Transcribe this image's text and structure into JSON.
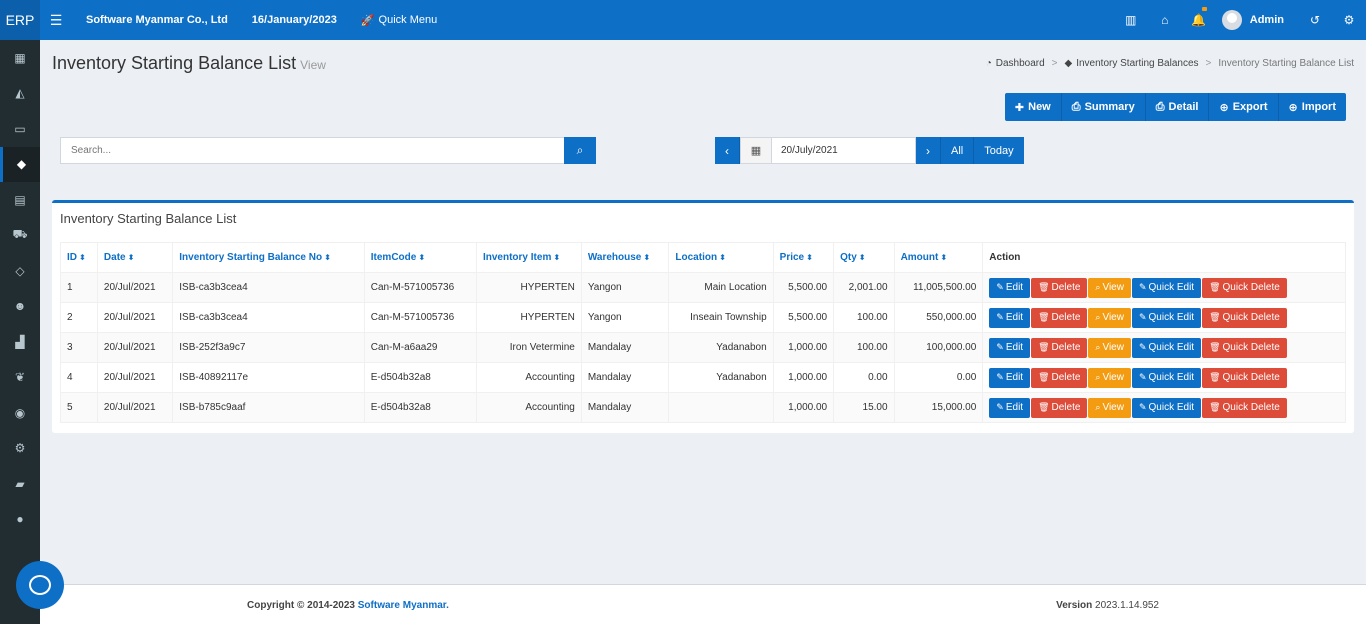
{
  "topbar": {
    "brand": "ERP",
    "company": "Software Myanmar Co., Ltd",
    "date": "16/January/2023",
    "quick_menu": "Quick Menu",
    "user": "Admin"
  },
  "page": {
    "title": "Inventory Starting Balance List",
    "subtitle": "View",
    "breadcrumb": [
      "Dashboard",
      "Inventory Starting Balances",
      "Inventory Starting Balance List"
    ]
  },
  "actions": [
    "New",
    "Summary",
    "Detail",
    "Export",
    "Import"
  ],
  "search": {
    "placeholder": "Search..."
  },
  "date_filter": {
    "value": "20/July/2021",
    "all": "All",
    "today": "Today"
  },
  "box_title": "Inventory Starting Balance List",
  "table": {
    "headers": [
      "ID",
      "Date",
      "Inventory Starting Balance No",
      "ItemCode",
      "Inventory Item",
      "Warehouse",
      "Location",
      "Price",
      "Qty",
      "Amount",
      "Action"
    ],
    "rows": [
      [
        "1",
        "20/Jul/2021",
        "ISB-ca3b3cea4",
        "Can-M-571005736",
        "HYPERTEN",
        "Yangon",
        "Main Location",
        "5,500.00",
        "2,001.00",
        "11,005,500.00"
      ],
      [
        "2",
        "20/Jul/2021",
        "ISB-ca3b3cea4",
        "Can-M-571005736",
        "HYPERTEN",
        "Yangon",
        "Inseain Township",
        "5,500.00",
        "100.00",
        "550,000.00"
      ],
      [
        "3",
        "20/Jul/2021",
        "ISB-252f3a9c7",
        "Can-M-a6aa29",
        "Iron Vetermine",
        "Mandalay",
        "Yadanabon",
        "1,000.00",
        "100.00",
        "100,000.00"
      ],
      [
        "4",
        "20/Jul/2021",
        "ISB-40892117e",
        "E-d504b32a8",
        "Accounting",
        "Mandalay",
        "Yadanabon",
        "1,000.00",
        "0.00",
        "0.00"
      ],
      [
        "5",
        "20/Jul/2021",
        "ISB-b785c9aaf",
        "E-d504b32a8",
        "Accounting",
        "Mandalay",
        "",
        "1,000.00",
        "15.00",
        "15,000.00"
      ]
    ],
    "row_actions": [
      "Edit",
      "Delete",
      "View",
      "Quick Edit",
      "Quick Delete"
    ]
  },
  "footer": {
    "copyright": "Copyright © 2014-2023",
    "link": "Software Myanmar.",
    "version_label": "Version",
    "version": "2023.1.14.952"
  },
  "colors": {
    "primary": "#0e6fc6",
    "danger": "#dd4b39",
    "warning": "#f39c12",
    "sidebar": "#222d32"
  }
}
